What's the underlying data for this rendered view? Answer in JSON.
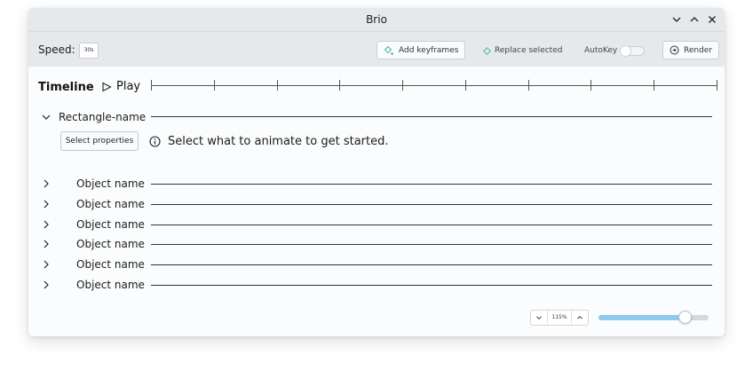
{
  "window": {
    "title": "Brio",
    "controls": [
      "chevron-down-icon",
      "chevron-up-icon",
      "close-icon"
    ]
  },
  "toolbar": {
    "speed_label": "Speed:",
    "speed_value": "30s",
    "add_keyframes_label": "Add keyframes",
    "replace_selected_label": "Replace selected",
    "autokey_label": "AutoKey",
    "autokey_on": false,
    "render_label": "Render"
  },
  "timeline": {
    "heading": "Timeline",
    "play_label": "Play",
    "tick_count": 10
  },
  "group": {
    "label": "Rectangle-name",
    "expanded": true,
    "select_properties_label": "Select properties",
    "hint": "Select what to animate to get started."
  },
  "objects": [
    {
      "label": "Object name",
      "expanded": false
    },
    {
      "label": "Object name",
      "expanded": false
    },
    {
      "label": "Object name",
      "expanded": false
    },
    {
      "label": "Object name",
      "expanded": false
    },
    {
      "label": "Object name",
      "expanded": false
    },
    {
      "label": "Object name",
      "expanded": false
    }
  ],
  "zoom": {
    "value_label": "115%",
    "slider_fraction": 0.78
  },
  "colors": {
    "accent": "#8ecbf0",
    "keyframe": "#3fb8a6",
    "chrome": "#e6e9ec"
  }
}
